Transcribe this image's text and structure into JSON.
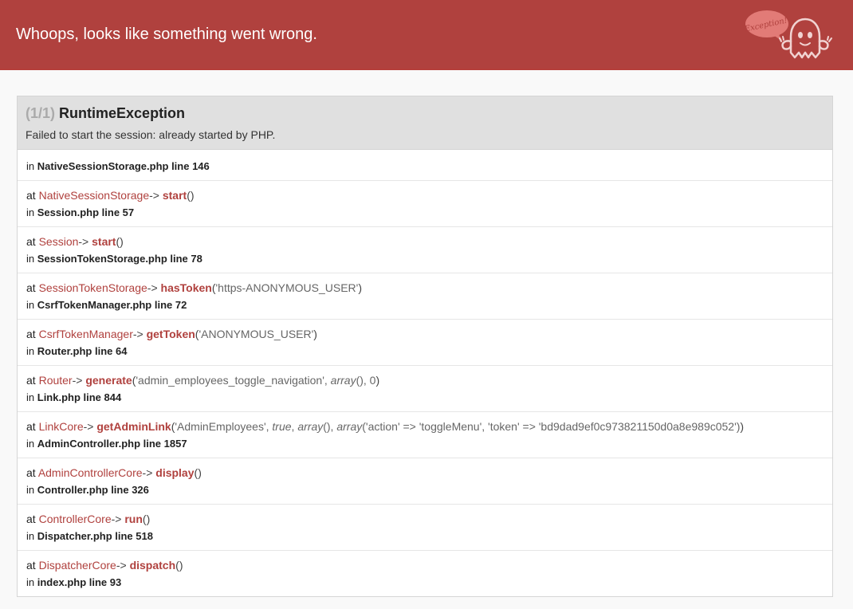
{
  "header": {
    "title": "Whoops, looks like something went wrong.",
    "mascot_bubble_text": "Exception!"
  },
  "exception": {
    "count": "(1/1)",
    "name": "RuntimeException",
    "message": "Failed to start the session: already started by PHP.",
    "origin_prefix": "in",
    "origin_file": "NativeSessionStorage.php line 146"
  },
  "frames": [
    {
      "at": "at",
      "class": "NativeSessionStorage",
      "arrow": "->",
      "method": "start",
      "open": "(",
      "args": "",
      "close": ")",
      "in": "in",
      "file": "Session.php line 57"
    },
    {
      "at": "at",
      "class": "Session",
      "arrow": "->",
      "method": "start",
      "open": "(",
      "args": "",
      "close": ")",
      "in": "in",
      "file": "SessionTokenStorage.php line 78"
    },
    {
      "at": "at",
      "class": "SessionTokenStorage",
      "arrow": "->",
      "method": "hasToken",
      "open": "(",
      "args": "'https-ANONYMOUS_USER'",
      "close": ")",
      "in": "in",
      "file": "CsrfTokenManager.php line 72"
    },
    {
      "at": "at",
      "class": "CsrfTokenManager",
      "arrow": "->",
      "method": "getToken",
      "open": "(",
      "args": "'ANONYMOUS_USER'",
      "close": ")",
      "in": "in",
      "file": "Router.php line 64"
    },
    {
      "at": "at",
      "class": "Router",
      "arrow": "->",
      "method": "generate",
      "open": "(",
      "args_parts": [
        "'admin_employees_toggle_navigation', ",
        "array",
        "(), 0"
      ],
      "close": ")",
      "in": "in",
      "file": "Link.php line 844"
    },
    {
      "at": "at",
      "class": "LinkCore",
      "arrow": "->",
      "method": "getAdminLink",
      "open": "(",
      "args_parts": [
        "'AdminEmployees', ",
        "true",
        ", ",
        "array",
        "(), ",
        "array",
        "('action' => 'toggleMenu', 'token' => 'bd9dad9ef0c973821150d0a8e989c052')"
      ],
      "close": ")",
      "in": "in",
      "file": "AdminController.php line 1857"
    },
    {
      "at": "at",
      "class": "AdminControllerCore",
      "arrow": "->",
      "method": "display",
      "open": "(",
      "args": "",
      "close": ")",
      "in": "in",
      "file": "Controller.php line 326"
    },
    {
      "at": "at",
      "class": "ControllerCore",
      "arrow": "->",
      "method": "run",
      "open": "(",
      "args": "",
      "close": ")",
      "in": "in",
      "file": "Dispatcher.php line 518"
    },
    {
      "at": "at",
      "class": "DispatcherCore",
      "arrow": "->",
      "method": "dispatch",
      "open": "(",
      "args": "",
      "close": ")",
      "in": "in",
      "file": "index.php line 93"
    }
  ],
  "colors": {
    "header_bg": "#b0413e",
    "accent": "#b0413e",
    "panel_head_bg": "#e0e0e0"
  },
  "icons": {
    "mascot": "ghost-mascot-icon"
  }
}
